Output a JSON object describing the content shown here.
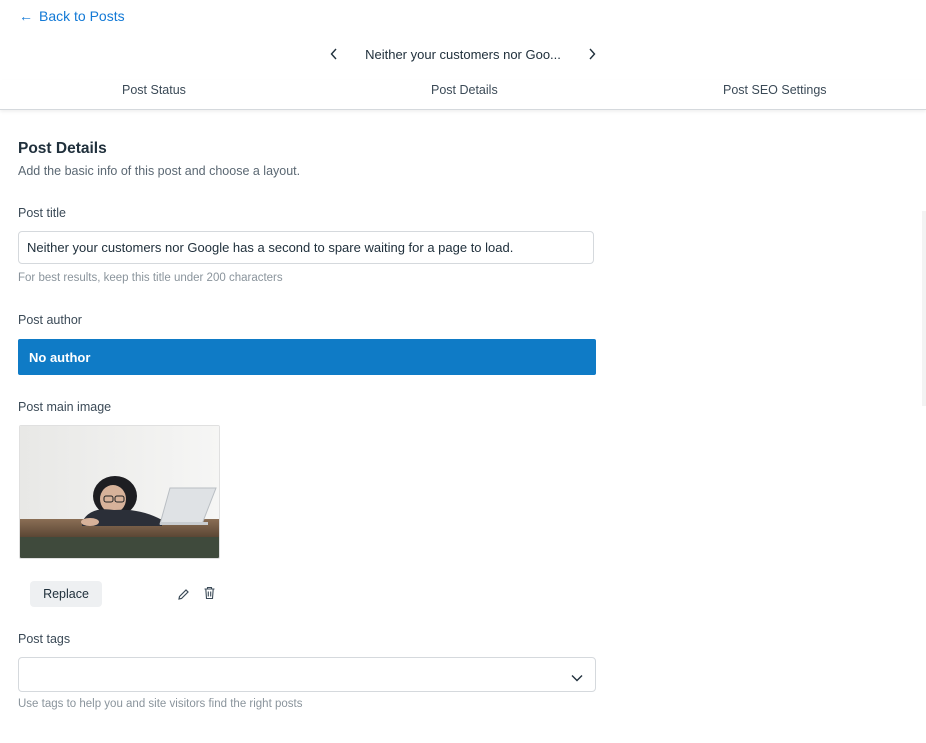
{
  "header": {
    "back_label": "Back to Posts",
    "post_nav_title": "Neither your customers nor Goo..."
  },
  "tabs": [
    {
      "label": "Post Status"
    },
    {
      "label": "Post Details"
    },
    {
      "label": "Post SEO Settings"
    }
  ],
  "section": {
    "title": "Post Details",
    "subtitle": "Add the basic info of this post and choose a layout."
  },
  "fields": {
    "title_label": "Post title",
    "title_value": "Neither your customers nor Google has a second to spare waiting for a page to load.",
    "title_hint": "For best results, keep this title under 200 characters",
    "author_label": "Post author",
    "author_value": "No author",
    "image_label": "Post main image",
    "replace_label": "Replace",
    "tags_label": "Post tags",
    "tags_hint": "Use tags to help you and site visitors find the right posts"
  },
  "colors": {
    "accent": "#1279d6",
    "author_bg": "#0f7bc6"
  },
  "icons": {
    "back": "arrow-left-icon",
    "prev": "chevron-left-icon",
    "next": "chevron-right-icon",
    "edit": "pencil-icon",
    "delete": "trash-icon",
    "dropdown": "chevron-down-icon"
  }
}
